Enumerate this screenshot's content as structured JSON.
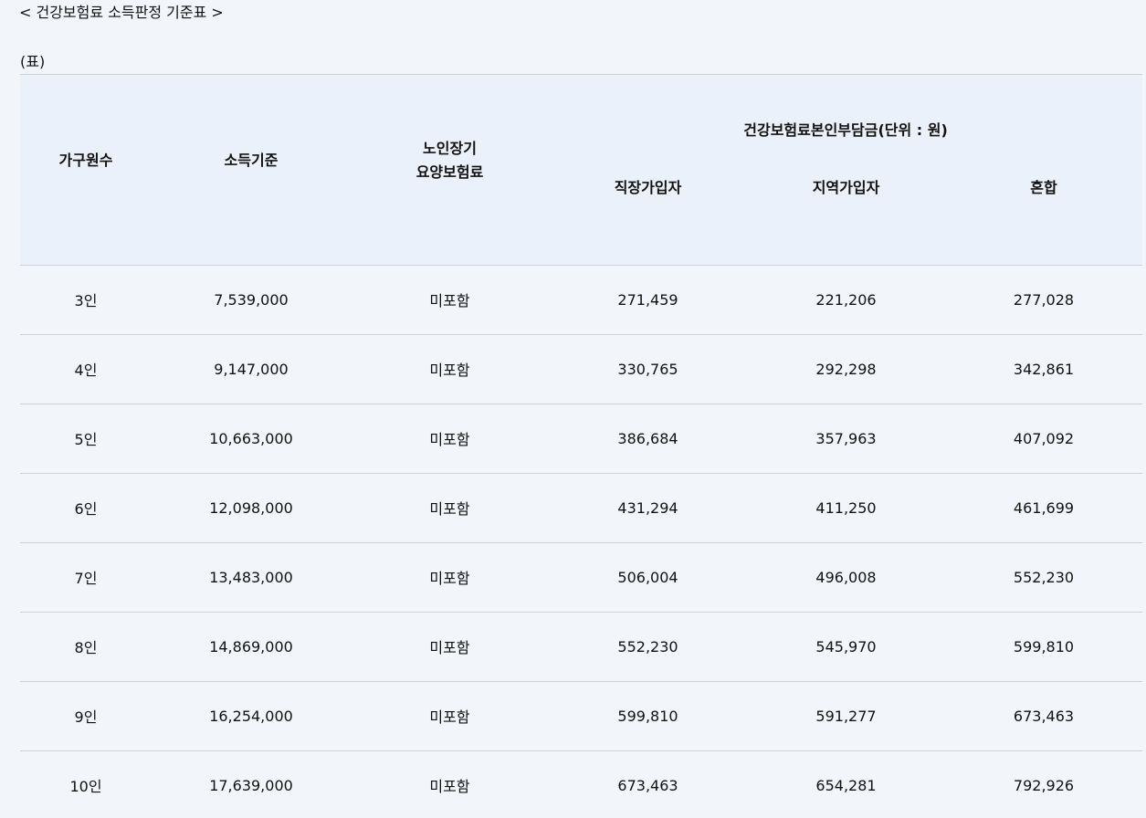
{
  "document": {
    "title": "< 건강보험료 소득판정 기준표 >",
    "caption": "(표)"
  },
  "table": {
    "headers": {
      "household": "가구원수",
      "income": "소득기준",
      "ltc_line1": "노인장기",
      "ltc_line2": "요양보험료",
      "group": "건강보험료본인부담금(단위 : 원)",
      "employee": "직장가입자",
      "regional": "지역가입자",
      "mixed": "혼합"
    },
    "rows": [
      {
        "household": "3인",
        "income": "7,539,000",
        "ltc": "미포함",
        "employee": "271,459",
        "regional": "221,206",
        "mixed": "277,028"
      },
      {
        "household": "4인",
        "income": "9,147,000",
        "ltc": "미포함",
        "employee": "330,765",
        "regional": "292,298",
        "mixed": "342,861"
      },
      {
        "household": "5인",
        "income": "10,663,000",
        "ltc": "미포함",
        "employee": "386,684",
        "regional": "357,963",
        "mixed": "407,092"
      },
      {
        "household": "6인",
        "income": "12,098,000",
        "ltc": "미포함",
        "employee": "431,294",
        "regional": "411,250",
        "mixed": "461,699"
      },
      {
        "household": "7인",
        "income": "13,483,000",
        "ltc": "미포함",
        "employee": "506,004",
        "regional": "496,008",
        "mixed": "552,230"
      },
      {
        "household": "8인",
        "income": "14,869,000",
        "ltc": "미포함",
        "employee": "552,230",
        "regional": "545,970",
        "mixed": "599,810"
      },
      {
        "household": "9인",
        "income": "16,254,000",
        "ltc": "미포함",
        "employee": "599,810",
        "regional": "591,277",
        "mixed": "673,463"
      },
      {
        "household": "10인",
        "income": "17,639,000",
        "ltc": "미포함",
        "employee": "673,463",
        "regional": "654,281",
        "mixed": "792,926"
      }
    ]
  },
  "colors": {
    "page_background": "#f2f5f9",
    "header_background": "#eaf1fa",
    "rule": "#cfd3d8"
  }
}
